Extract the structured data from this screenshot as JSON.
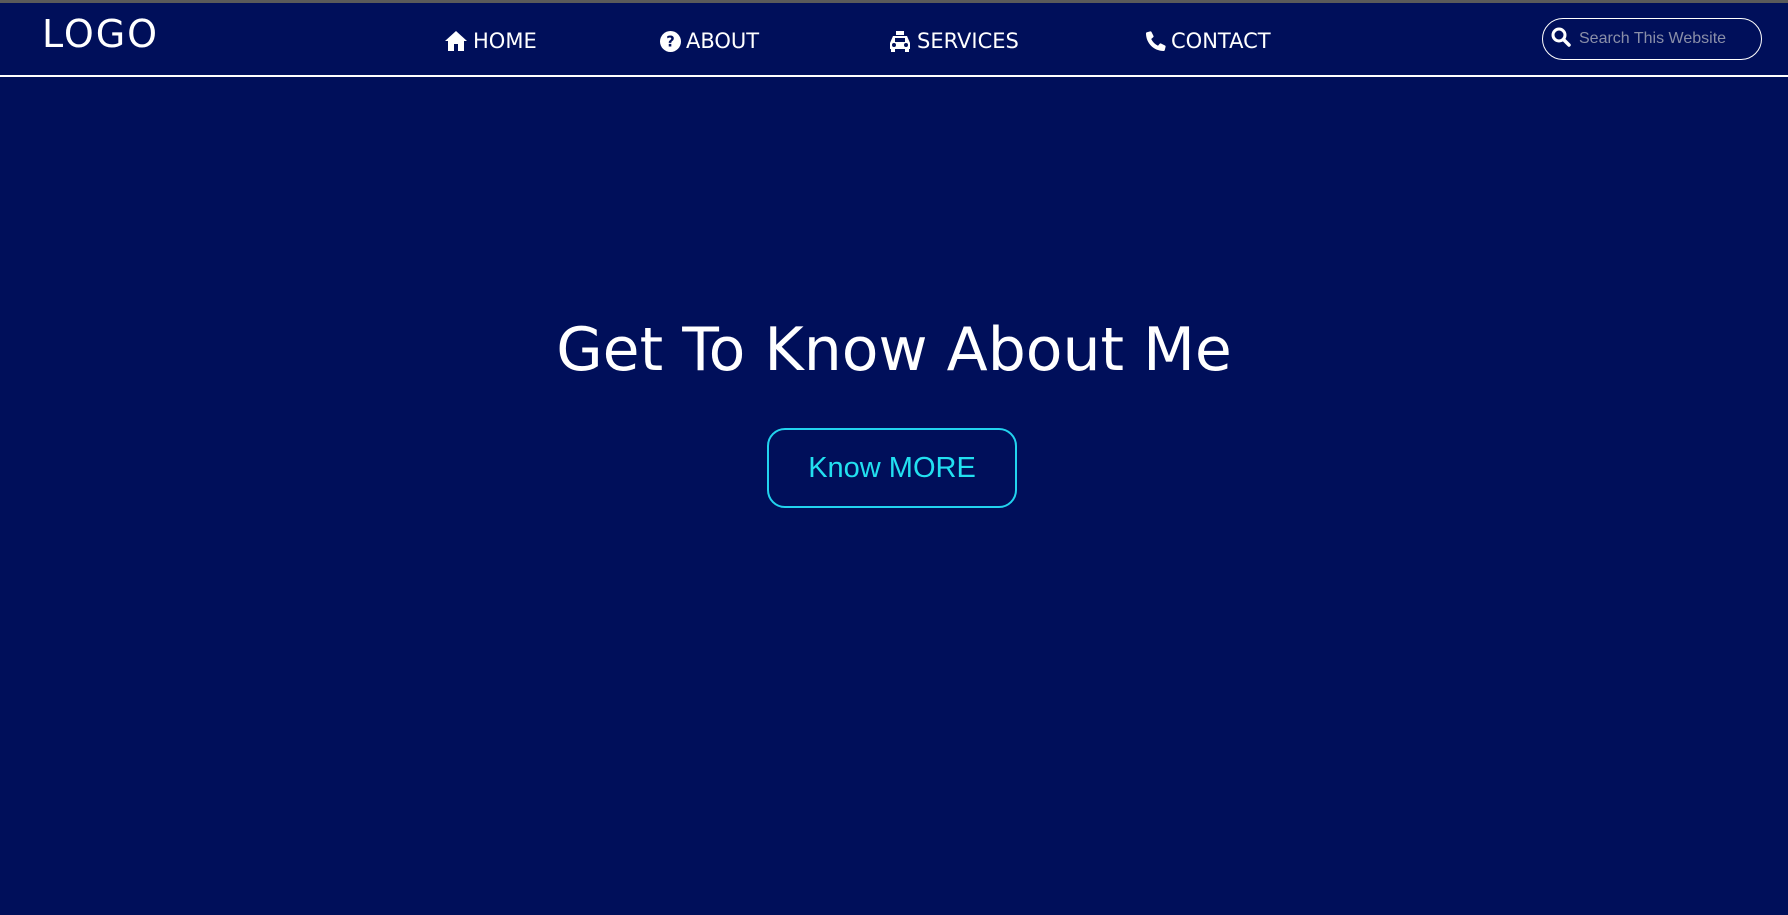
{
  "header": {
    "logo": "LOGO",
    "nav": [
      {
        "label": "HOME",
        "icon": "home-icon"
      },
      {
        "label": "ABOUT",
        "icon": "question-circle-icon"
      },
      {
        "label": "SERVICES",
        "icon": "taxi-icon"
      },
      {
        "label": "CONTACT",
        "icon": "phone-icon"
      }
    ],
    "search": {
      "placeholder": "Search This Website",
      "value": "",
      "icon": "search-icon"
    }
  },
  "hero": {
    "title": "Get To Know About Me",
    "button_label": "Know MORE"
  },
  "colors": {
    "background": "#000f5a",
    "text": "#ffffff",
    "accent": "#22d3ee",
    "topline": "#5a5a5a"
  }
}
